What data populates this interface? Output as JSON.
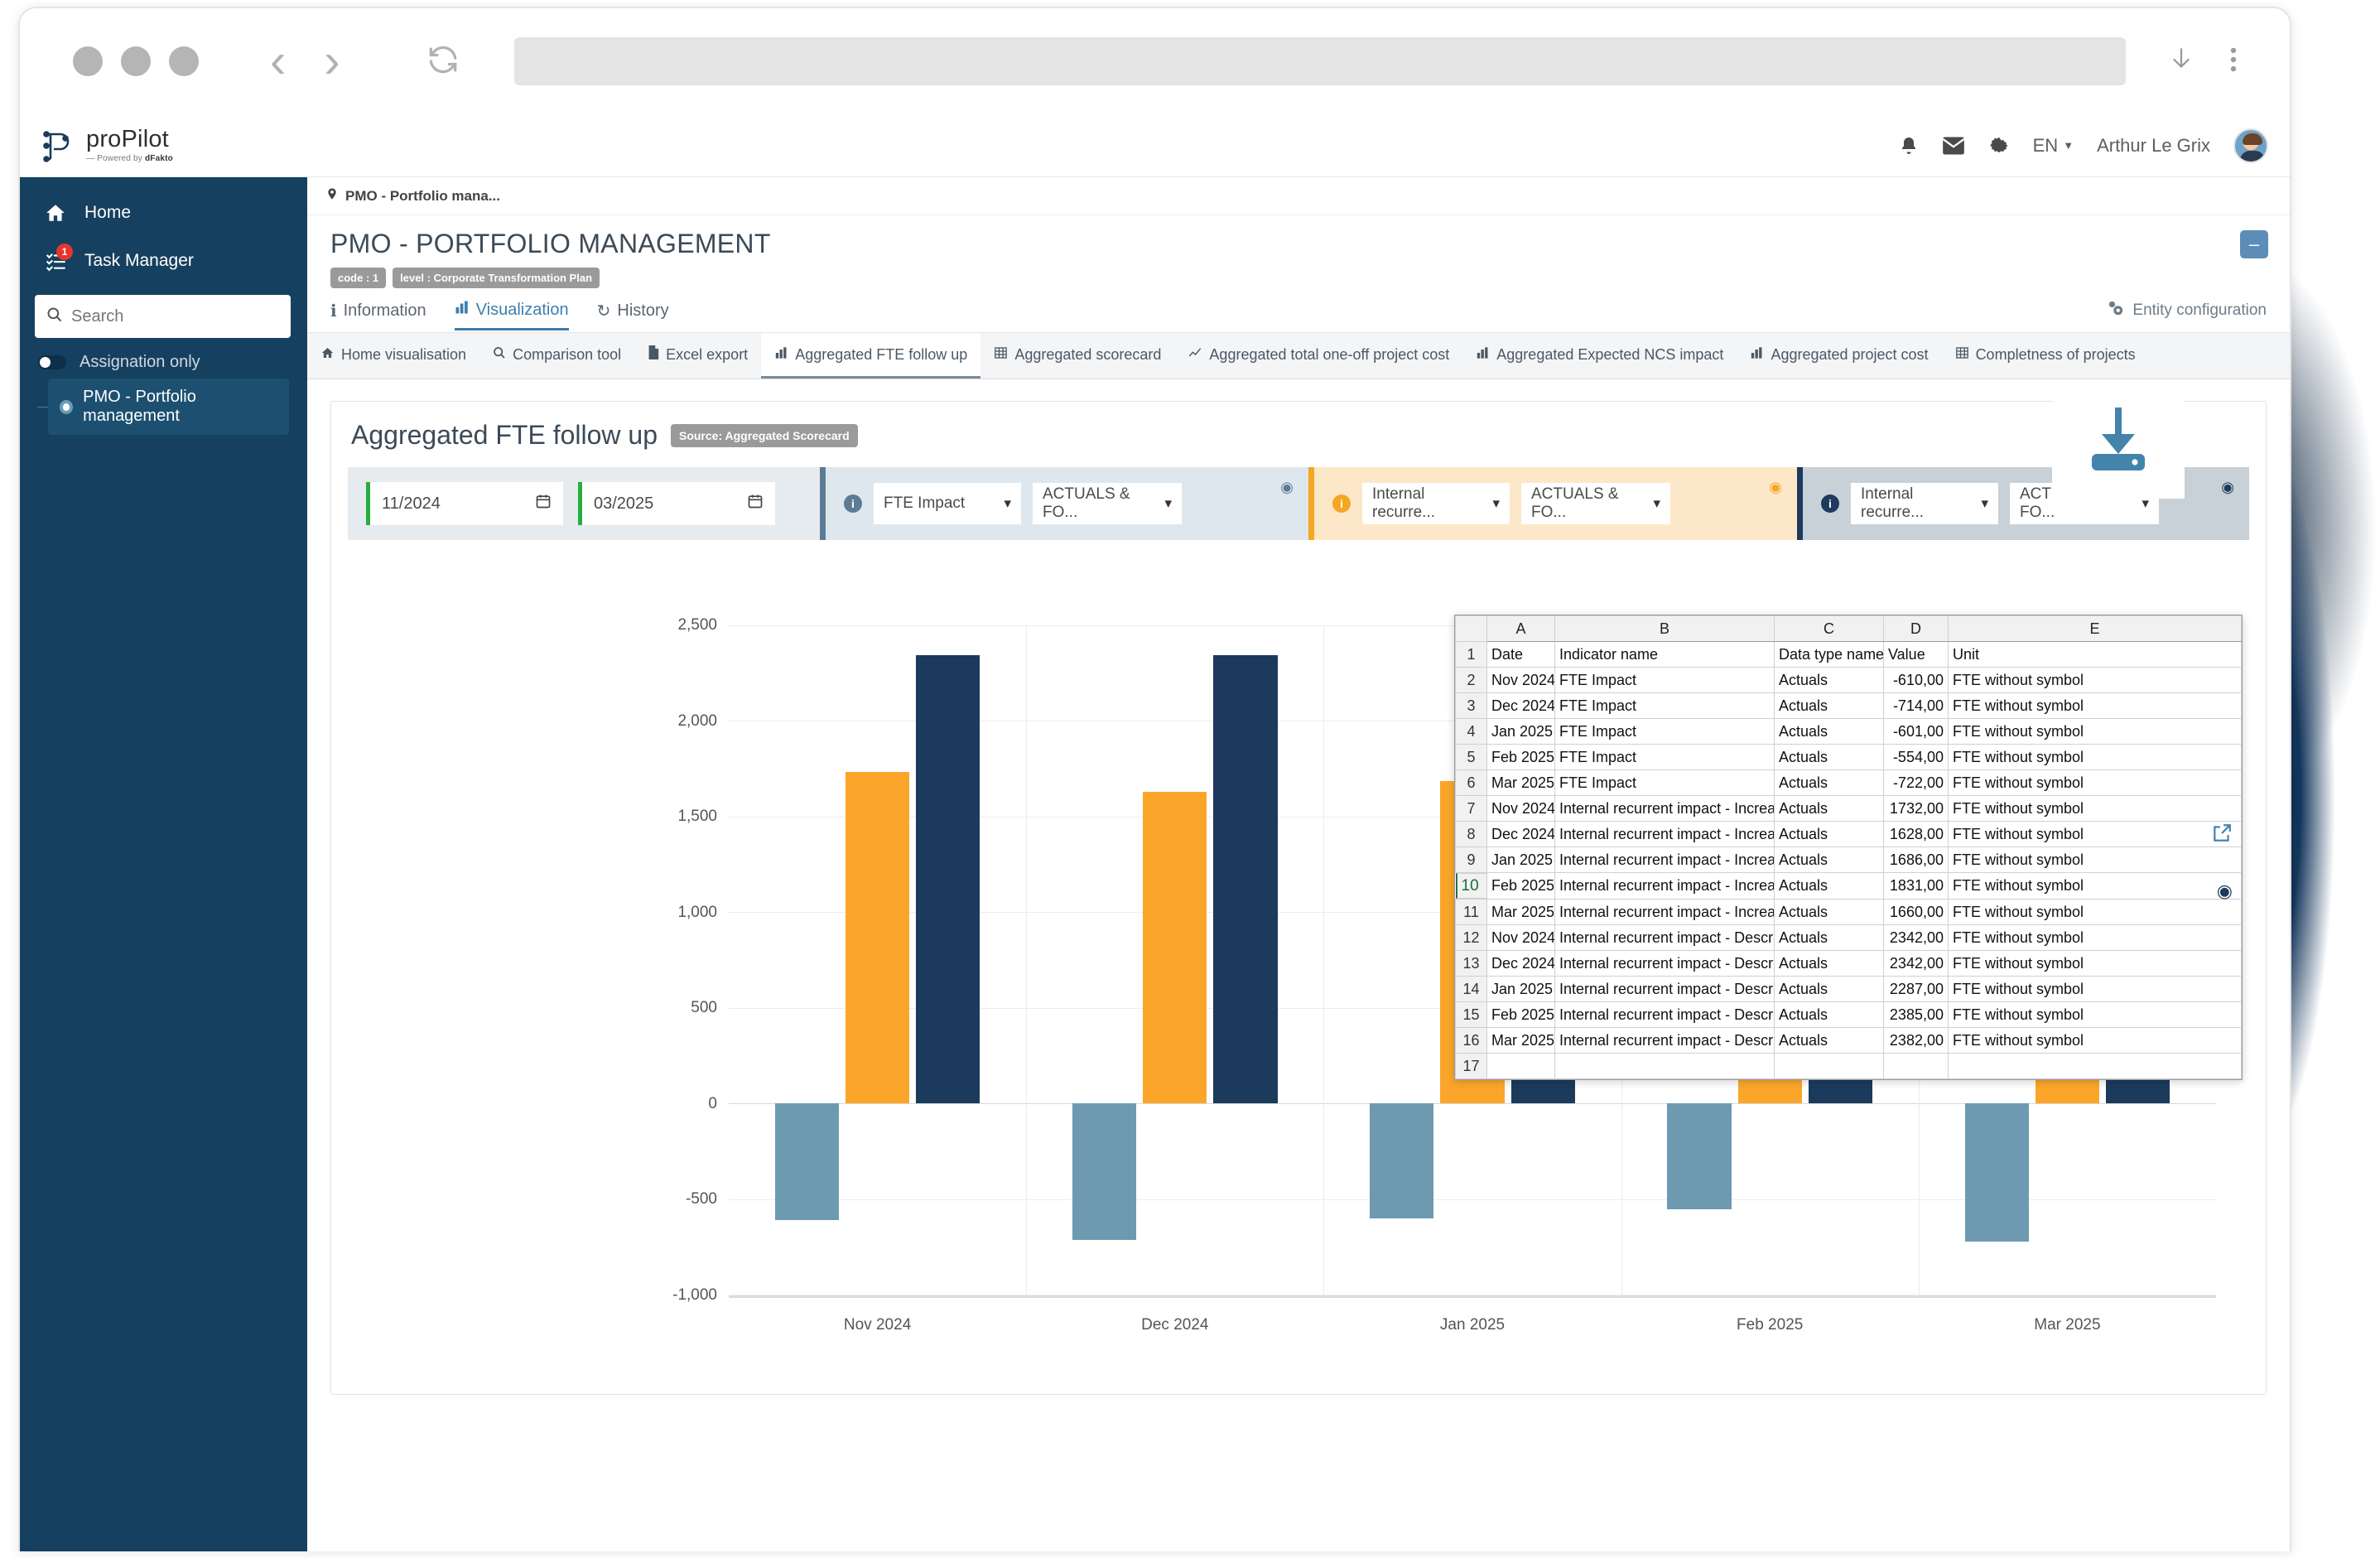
{
  "browser": {
    "back_icon": "chevron-left-icon",
    "forward_icon": "chevron-right-icon",
    "reload_icon": "reload-icon",
    "url": "",
    "download_icon": "download-arrow-icon",
    "menu_icon": "kebab-menu-icon"
  },
  "appbar": {
    "logo_name": "proPilot",
    "logo_sub_prefix": "— Powered by ",
    "logo_sub_brand": "dFakto",
    "bell_icon": "bell-icon",
    "mail_icon": "envelope-icon",
    "gear_icon": "gear-icon",
    "language": "EN",
    "username": "Arthur Le Grix",
    "avatar": "user-avatar"
  },
  "sidebar": {
    "items": [
      {
        "label": "Home",
        "icon": "home-icon"
      },
      {
        "label": "Task Manager",
        "icon": "task-list-icon",
        "badge": "1"
      }
    ],
    "search_placeholder": "Search",
    "search_value": "",
    "search_icon": "search-icon",
    "assignation_label": "Assignation only",
    "assignation_on": false,
    "tree_item": "PMO - Portfolio management"
  },
  "breadcrumb": {
    "icon": "location-pin-icon",
    "text": "PMO - Portfolio mana..."
  },
  "page": {
    "title": "PMO - PORTFOLIO MANAGEMENT",
    "chips": [
      "code : 1",
      "level : Corporate Transformation Plan"
    ],
    "minimize_icon": "minimize-icon",
    "entity_config": "Entity configuration",
    "entity_config_icon": "gears-icon"
  },
  "subtabs": [
    {
      "label": "Information",
      "icon": "info-icon",
      "active": false
    },
    {
      "label": "Visualization",
      "icon": "chart-icon",
      "active": true
    },
    {
      "label": "History",
      "icon": "history-icon",
      "active": false
    }
  ],
  "viztabs": [
    {
      "label": "Home visualisation",
      "icon": "home-icon",
      "active": false
    },
    {
      "label": "Comparison tool",
      "icon": "search-icon",
      "active": false
    },
    {
      "label": "Excel export",
      "icon": "file-icon",
      "active": false
    },
    {
      "label": "Aggregated FTE follow up",
      "icon": "bar-chart-icon",
      "active": true
    },
    {
      "label": "Aggregated scorecard",
      "icon": "grid-icon",
      "active": false
    },
    {
      "label": "Aggregated total one-off project cost",
      "icon": "line-chart-icon",
      "active": false
    },
    {
      "label": "Aggregated Expected NCS impact",
      "icon": "bar-chart-icon",
      "active": false
    },
    {
      "label": "Aggregated project cost",
      "icon": "bar-chart-icon",
      "active": false
    },
    {
      "label": "Completness of projects",
      "icon": "grid-icon",
      "active": false
    }
  ],
  "card": {
    "title": "Aggregated FTE follow up",
    "source_badge": "Source: Aggregated Scorecard",
    "expand_icon": "external-link-icon",
    "eye_icon": "eye-icon",
    "filters": {
      "date_from": "11/2024",
      "date_to": "03/2025",
      "calendar_icon": "calendar-icon",
      "groups": [
        {
          "color": "#5c7c96",
          "indicator": "FTE Impact",
          "datatype": "ACTUALS & FO...",
          "eye": "eye-icon"
        },
        {
          "color": "#f5a623",
          "indicator": "Internal recurre...",
          "datatype": "ACTUALS & FO...",
          "eye": "eye-icon"
        },
        {
          "color": "#1d3a5c",
          "indicator": "Internal recurre...",
          "datatype": "ACTUALS & FO...",
          "eye": "eye-icon"
        }
      ]
    }
  },
  "chart_data": {
    "type": "bar",
    "title": "Aggregated FTE follow up",
    "xlabel": "",
    "ylabel": "",
    "ylim": [
      -1000,
      2500
    ],
    "yticks": [
      2500,
      2000,
      1500,
      1000,
      500,
      0,
      -500,
      -1000
    ],
    "ytick_labels": [
      "2,500",
      "2,000",
      "1,500",
      "1,000",
      "500",
      "0",
      "-500",
      "-1,000"
    ],
    "grid": true,
    "legend": "none",
    "categories": [
      "Nov 2024",
      "Dec 2024",
      "Jan 2025",
      "Feb 2025",
      "Mar 2025"
    ],
    "series": [
      {
        "name": "FTE Impact",
        "color": "#6d9ab1",
        "values": [
          -610,
          -714,
          -601,
          -554,
          -722
        ]
      },
      {
        "name": "Internal recurrent impact - Increase",
        "color": "#fba62a",
        "values": [
          1732,
          1628,
          1686,
          1831,
          1660
        ]
      },
      {
        "name": "Internal recurrent impact - Descrease",
        "color": "#1b3a5c",
        "values": [
          2342,
          2342,
          2287,
          2385,
          2382
        ]
      }
    ]
  },
  "spreadsheet": {
    "columns": [
      "A",
      "B",
      "C",
      "D",
      "E"
    ],
    "header_row": [
      "Date",
      "Indicator name",
      "Data type name",
      "Value",
      "Unit"
    ],
    "selected_row": 10,
    "rows": [
      [
        "Nov 2024",
        "FTE Impact",
        "Actuals",
        "-610,00",
        "FTE without symbol"
      ],
      [
        "Dec 2024",
        "FTE Impact",
        "Actuals",
        "-714,00",
        "FTE without symbol"
      ],
      [
        "Jan 2025",
        "FTE Impact",
        "Actuals",
        "-601,00",
        "FTE without symbol"
      ],
      [
        "Feb 2025",
        "FTE Impact",
        "Actuals",
        "-554,00",
        "FTE without symbol"
      ],
      [
        "Mar 2025",
        "FTE Impact",
        "Actuals",
        "-722,00",
        "FTE without symbol"
      ],
      [
        "Nov 2024",
        "Internal recurrent impact - Increase",
        "Actuals",
        "1732,00",
        "FTE without symbol"
      ],
      [
        "Dec 2024",
        "Internal recurrent impact - Increase",
        "Actuals",
        "1628,00",
        "FTE without symbol"
      ],
      [
        "Jan 2025",
        "Internal recurrent impact - Increase",
        "Actuals",
        "1686,00",
        "FTE without symbol"
      ],
      [
        "Feb 2025",
        "Internal recurrent impact - Increase",
        "Actuals",
        "1831,00",
        "FTE without symbol"
      ],
      [
        "Mar 2025",
        "Internal recurrent impact - Increase",
        "Actuals",
        "1660,00",
        "FTE without symbol"
      ],
      [
        "Nov 2024",
        "Internal recurrent impact - Descrease",
        "Actuals",
        "2342,00",
        "FTE without symbol"
      ],
      [
        "Dec 2024",
        "Internal recurrent impact - Descrease",
        "Actuals",
        "2342,00",
        "FTE without symbol"
      ],
      [
        "Jan 2025",
        "Internal recurrent impact - Descrease",
        "Actuals",
        "2287,00",
        "FTE without symbol"
      ],
      [
        "Feb 2025",
        "Internal recurrent impact - Descrease",
        "Actuals",
        "2385,00",
        "FTE without symbol"
      ],
      [
        "Mar 2025",
        "Internal recurrent impact - Descrease",
        "Actuals",
        "2382,00",
        "FTE without symbol"
      ],
      [
        "",
        "",
        "",
        "",
        ""
      ]
    ]
  },
  "overlay": {
    "download_icon": "download-tray-icon"
  }
}
